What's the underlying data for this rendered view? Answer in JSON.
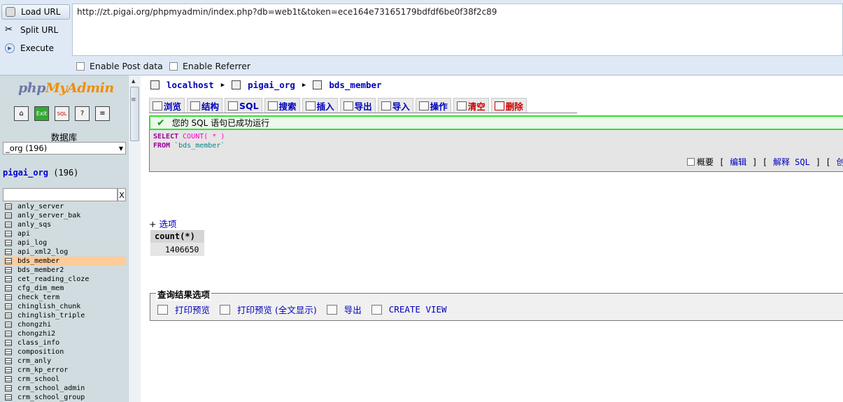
{
  "hackbar": {
    "load_label": "Load URL",
    "split_label": "Split URL",
    "execute_label": "Execute",
    "url": "http://zt.pigai.org/phpmyadmin/index.php?db=web1t&token=ece164e73165179bdfdf6be0f38f2c89",
    "enable_post": "Enable Post data",
    "enable_referrer": "Enable Referrer"
  },
  "sidebar": {
    "logo_php": "php",
    "logo_my": "My",
    "logo_admin": "Admin",
    "db_label": "数据库",
    "db_select": "_org (196)",
    "db_name": "pigai_org",
    "db_count": "(196)",
    "filter_clear": "X",
    "tables": [
      "anly_server",
      "anly_server_bak",
      "anly_sqs",
      "api",
      "api_log",
      "api_xml2_log",
      "bds_member",
      "bds_member2",
      "cet_reading_cloze",
      "cfg_dim_mem",
      "check_term",
      "chinglish_chunk",
      "chinglish_triple",
      "chongzhi",
      "chongzhi2",
      "class_info",
      "composition",
      "crm_anly",
      "crm_kp_error",
      "crm_school",
      "crm_school_admin",
      "crm_school_group"
    ],
    "selected_table": "bds_member"
  },
  "breadcrumb": {
    "server": "localhost",
    "database": "pigai_org",
    "table": "bds_member"
  },
  "tabs": [
    "浏览",
    "结构",
    "SQL",
    "搜索",
    "插入",
    "导出",
    "导入",
    "操作",
    "清空",
    "删除"
  ],
  "result": {
    "success_msg": "您的 SQL 语句已成功运行",
    "sql_select": "SELECT",
    "sql_count": "COUNT( * )",
    "sql_from": "FROM",
    "sql_table": "`bds_member`",
    "profile": "概要",
    "edit": "编辑",
    "explain": "解释 SQL",
    "create": "创",
    "options": "选项",
    "col_header": "count(*)",
    "value": "1406650"
  },
  "query_ops": {
    "legend": "查询结果选项",
    "print": "打印预览",
    "print_full": "打印预览 (全文显示)",
    "export": "导出",
    "create_view": "CREATE VIEW"
  }
}
